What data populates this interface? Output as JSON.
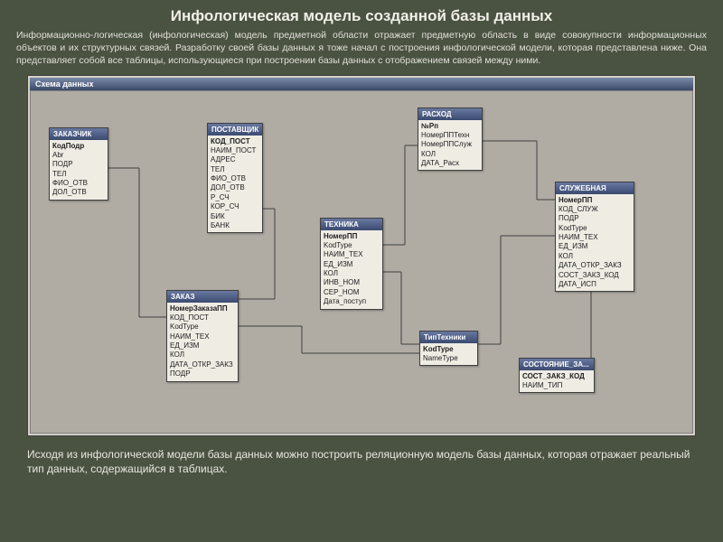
{
  "title": "Инфологическая модель созданной базы данных",
  "intro": "Информационно-логическая (инфологическая) модель предметной области отражает предметную область в виде совокупности информационных объектов и их структурных связей. Разработку своей базы данных я тоже начал с построения инфологической модели, которая представлена ниже. Она представляет собой все таблицы, использующиеся при построении базы данных с отображением связей между ними.",
  "outro": "Исходя из инфологической модели базы данных можно построить реляционную модель базы данных, которая отражает реальный тип данных, содержащийся в таблицах.",
  "window_title": "Схема данных",
  "tables": {
    "zakazchik": {
      "title": "ЗАКАЗЧИК",
      "fields": [
        "КодПодр",
        "Abr",
        "ПОДР",
        "ТЕЛ",
        "ФИО_ОТВ",
        "ДОЛ_ОТВ"
      ]
    },
    "postavshik": {
      "title": "ПОСТАВЩИК",
      "fields": [
        "КОД_ПОСТ",
        "НАИМ_ПОСТ",
        "АДРЕС",
        "ТЕЛ",
        "ФИО_ОТВ",
        "ДОЛ_ОТВ",
        "Р_СЧ",
        "КОР_СЧ",
        "БИК",
        "БАНК"
      ]
    },
    "rashod": {
      "title": "РАСХОД",
      "fields": [
        "№Рп",
        "НомерППТехн",
        "НомерППСлуж",
        "КОЛ",
        "ДАТА_Расх"
      ]
    },
    "tehnika": {
      "title": "ТЕХНИКА",
      "fields": [
        "НомерПП",
        "KodType",
        "НАИМ_ТЕХ",
        "ЕД_ИЗМ",
        "КОЛ",
        "ИНВ_НОМ",
        "СЕР_НОМ",
        "Дата_поступ"
      ]
    },
    "sluzhebnaya": {
      "title": "СЛУЖЕБНАЯ",
      "fields": [
        "НомерПП",
        "КОД_СЛУЖ",
        "ПОДР",
        "KodType",
        "НАИМ_ТЕХ",
        "ЕД_ИЗМ",
        "КОЛ",
        "ДАТА_ОТКР_ЗАКЗ",
        "СОСТ_ЗАКЗ_КОД",
        "ДАТА_ИСП"
      ]
    },
    "zakaz": {
      "title": "ЗАКАЗ",
      "fields": [
        "НомерЗаказаПП",
        "КОД_ПОСТ",
        "KodType",
        "НАИМ_ТЕХ",
        "ЕД_ИЗМ",
        "КОЛ",
        "ДАТА_ОТКР_ЗАКЗ",
        "ПОДР"
      ]
    },
    "tiptehniki": {
      "title": "ТипТехники",
      "fields": [
        "KodType",
        "NameType"
      ]
    },
    "sostoyanie": {
      "title": "СОСТОЯНИЕ_ЗА...",
      "fields": [
        "СОСТ_ЗАКЗ_КОД",
        "НАИМ_ТИП"
      ]
    }
  }
}
